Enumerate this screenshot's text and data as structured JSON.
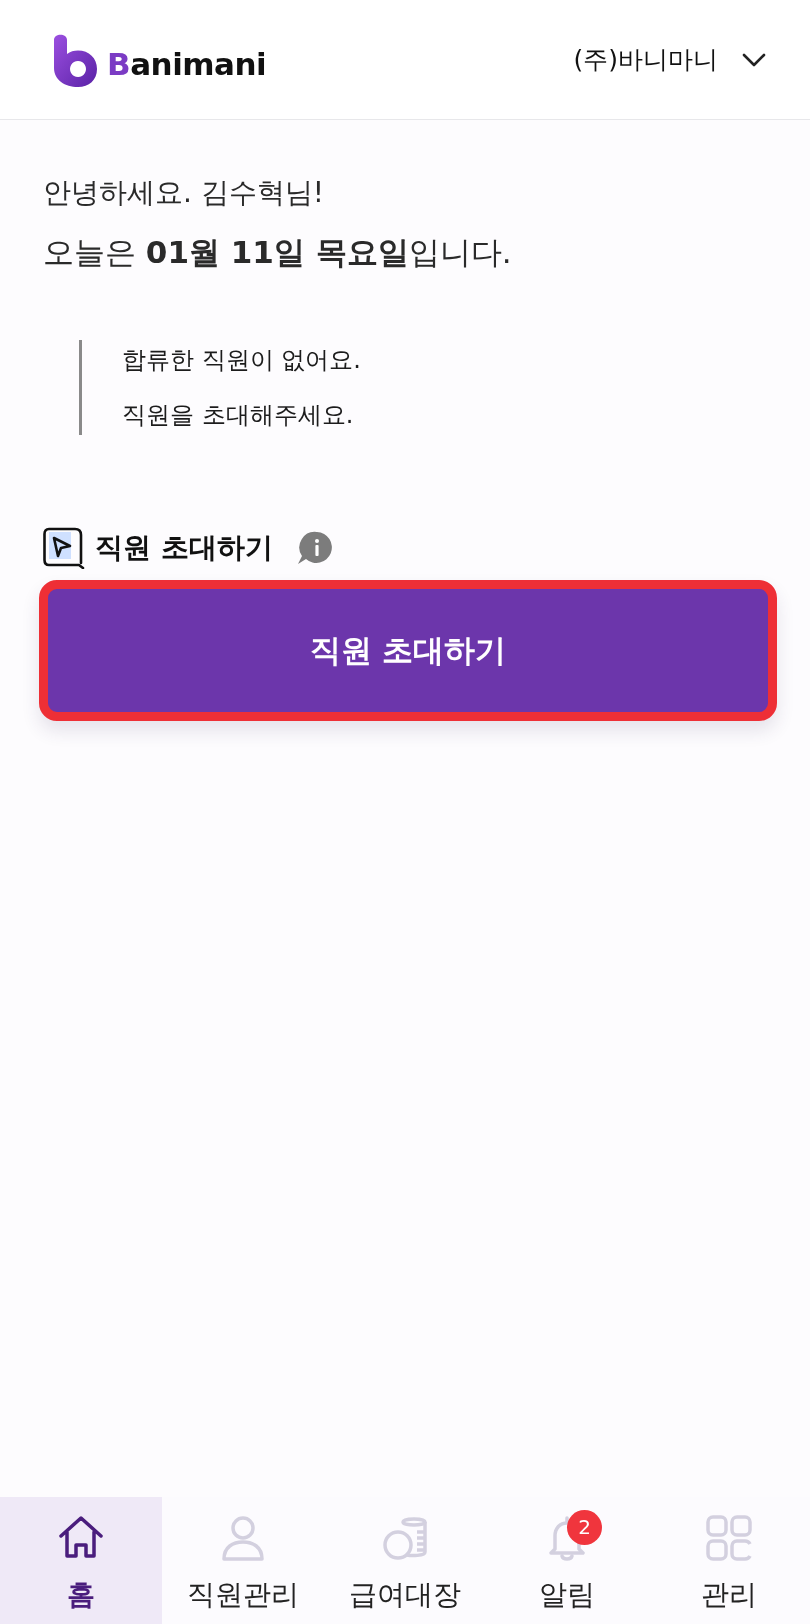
{
  "header": {
    "brand": "Banimani",
    "company": "(주)바니마니"
  },
  "greeting": {
    "line_1": "안녕하세요. 김수혁님!",
    "line_2": "오늘은 **01월 11일 목요일**입니다."
  },
  "notice": {
    "lines": [
      "합류한 직원이 없어요.",
      "직원을 초대해주세요."
    ]
  },
  "invite_section": {
    "title": "직원 초대하기",
    "button": "직원 초대하기"
  },
  "tab_bar": {
    "tabs": [
      {
        "label": "홈",
        "kind": "home",
        "selected": true
      },
      {
        "label": "직원관리",
        "kind": "person",
        "selected": false
      },
      {
        "label": "급여대장",
        "kind": "coins",
        "selected": false
      },
      {
        "label": "알림",
        "kind": "bell",
        "selected": false,
        "badge": "2"
      },
      {
        "label": "관리",
        "kind": "grid",
        "selected": false
      }
    ]
  }
}
